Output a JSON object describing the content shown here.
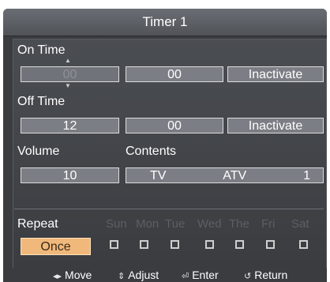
{
  "title": "Timer 1",
  "on_time": {
    "label": "On Time",
    "hour": "00",
    "minute": "00",
    "status": "Inactivate"
  },
  "off_time": {
    "label": "Off Time",
    "hour": "12",
    "minute": "00",
    "status": "Inactivate"
  },
  "volume": {
    "label": "Volume",
    "value": "10"
  },
  "contents": {
    "label": "Contents",
    "source": "TV",
    "band": "ATV",
    "channel": "1"
  },
  "repeat": {
    "label": "Repeat",
    "value": "Once",
    "days": [
      "Sun",
      "Mon",
      "Tue",
      "Wed",
      "The",
      "Fri",
      "Sat"
    ]
  },
  "footer": {
    "move": "Move",
    "adjust": "Adjust",
    "enter": "Enter",
    "return": "Return"
  },
  "colors": {
    "panel_bg": "#3a3c40",
    "field_bg": "#7b7e84",
    "selected_bg": "#f0b87a"
  }
}
